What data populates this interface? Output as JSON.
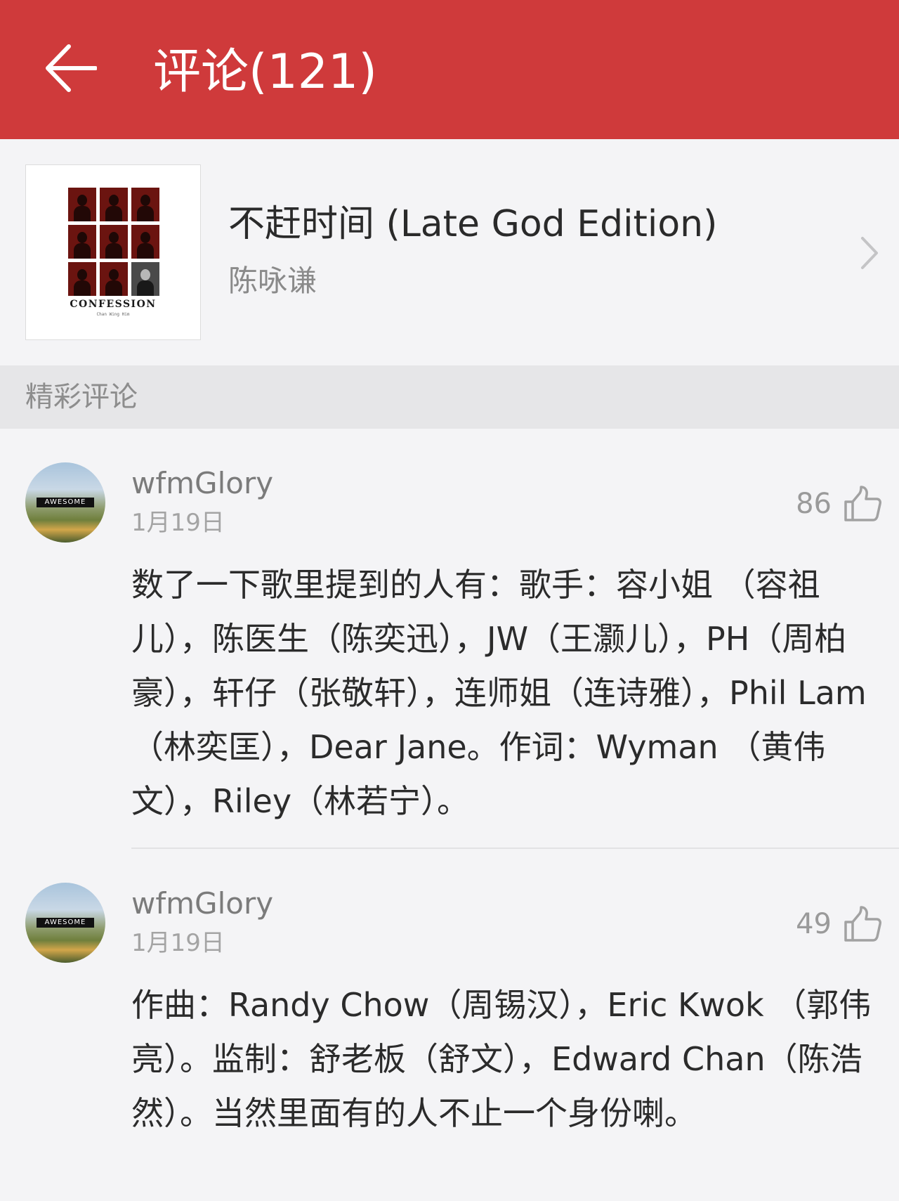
{
  "header": {
    "title": "评论(121)",
    "back_icon": "arrow-left-icon",
    "background_color": "#cf3a3b"
  },
  "song": {
    "title": "不赶时间 (Late God Edition)",
    "artist": "陈咏谦",
    "cover": {
      "title": "CONFESSION",
      "subtitle": "Chan Wing Him"
    },
    "chevron_icon": "chevron-right-icon"
  },
  "section": {
    "title": "精彩评论"
  },
  "comments": [
    {
      "avatar_label": "AWESOME",
      "username": "wfmGlory",
      "date": "1月19日",
      "likes": "86",
      "like_icon": "thumbs-up-icon",
      "text": "数了一下歌里提到的人有：歌手：容小姐 （容祖儿），陈医生（陈奕迅），JW（王灏儿），PH（周柏豪），轩仔（张敬轩），连师姐（连诗雅），Phil Lam（林奕匡），Dear Jane。作词：Wyman （黄伟文），Riley（林若宁）。"
    },
    {
      "avatar_label": "AWESOME",
      "username": "wfmGlory",
      "date": "1月19日",
      "likes": "49",
      "like_icon": "thumbs-up-icon",
      "text": "作曲：Randy Chow（周锡汉），Eric Kwok （郭伟亮）。监制：舒老板（舒文），Edward Chan（陈浩然）。当然里面有的人不止一个身份喇。"
    }
  ]
}
